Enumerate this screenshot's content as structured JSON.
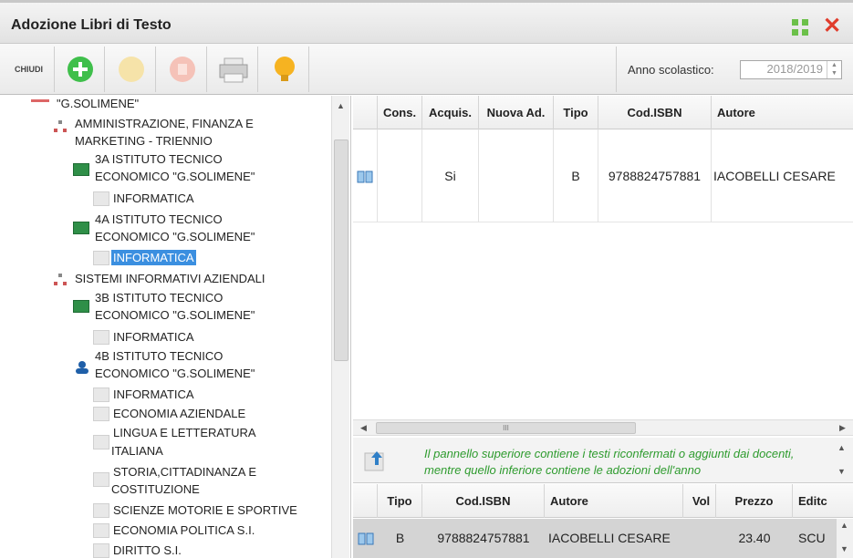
{
  "window": {
    "title": "Adozione Libri di Testo"
  },
  "toolbar": {
    "close_label": "CHIUDI",
    "anno_label": "Anno scolastico:",
    "anno_value": "2018/2019"
  },
  "tree": {
    "items": [
      {
        "label": "\"G.SOLIMENE\""
      },
      {
        "label": "AMMINISTRAZIONE, FINANZA E"
      },
      {
        "label": "MARKETING - TRIENNIO"
      },
      {
        "label": "3A ISTITUTO TECNICO"
      },
      {
        "label": "ECONOMICO \"G.SOLIMENE\""
      },
      {
        "label": "INFORMATICA"
      },
      {
        "label": "4A ISTITUTO TECNICO"
      },
      {
        "label": "ECONOMICO \"G.SOLIMENE\""
      },
      {
        "label": "INFORMATICA"
      },
      {
        "label": "SISTEMI INFORMATIVI AZIENDALI"
      },
      {
        "label": "3B ISTITUTO TECNICO"
      },
      {
        "label": "ECONOMICO \"G.SOLIMENE\""
      },
      {
        "label": "INFORMATICA"
      },
      {
        "label": "4B ISTITUTO TECNICO"
      },
      {
        "label": "ECONOMICO \"G.SOLIMENE\""
      },
      {
        "label": "INFORMATICA"
      },
      {
        "label": "ECONOMIA AZIENDALE"
      },
      {
        "label": "LINGUA E LETTERATURA"
      },
      {
        "label": "ITALIANA"
      },
      {
        "label": "STORIA,CITTADINANZA E"
      },
      {
        "label": "COSTITUZIONE"
      },
      {
        "label": "SCIENZE MOTORIE E SPORTIVE"
      },
      {
        "label": "ECONOMIA POLITICA S.I."
      },
      {
        "label": "DIRITTO S.I."
      }
    ]
  },
  "upper_grid": {
    "headers": [
      "Cons.",
      "Acquis.",
      "Nuova Ad.",
      "Tipo",
      "Cod.ISBN",
      "Autore"
    ],
    "row": {
      "acquis": "Si",
      "tipo": "B",
      "isbn": "9788824757881",
      "autore": "IACOBELLI CESARE"
    }
  },
  "note": {
    "text": "Il pannello superiore contiene i testi riconfermati o aggiunti dai docenti, mentre quello inferiore contiene le adozioni dell'anno"
  },
  "lower_grid": {
    "headers": [
      "Tipo",
      "Cod.ISBN",
      "Autore",
      "Vol",
      "Prezzo",
      "Editc"
    ],
    "row": {
      "tipo": "B",
      "isbn": "9788824757881",
      "autore": "IACOBELLI CESARE",
      "prezzo": "23.40",
      "editore": "SCU"
    }
  },
  "colors": {
    "accent_green": "#2e9b2e",
    "selection_blue": "#3b8fe0",
    "close_red": "#e03c2c"
  }
}
